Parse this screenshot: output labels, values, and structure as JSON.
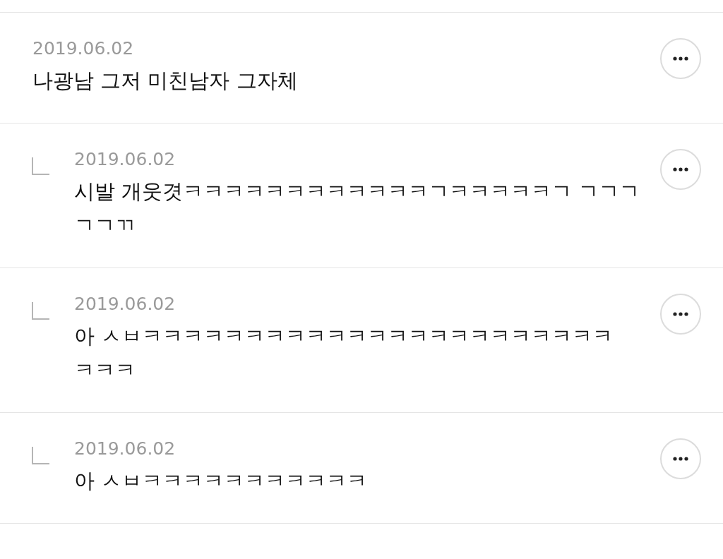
{
  "comments": [
    {
      "kind": "comment",
      "date": "2019.06.02",
      "lines": [
        "나광남 그저 미친남자 그자체"
      ]
    },
    {
      "kind": "reply",
      "date": "2019.06.02",
      "lines": [
        "시발 개웃겻ㅋㅋㅋㅋㅋㅋㅋㅋㅋㅋㅋㅋㄱㅋㅋㅋㅋㅋㄱ ㄱㄱㄱ",
        "ㄱㄱㄲ"
      ]
    },
    {
      "kind": "reply",
      "date": "2019.06.02",
      "lines": [
        "아 ㅅㅂㅋㅋㅋㅋㅋㅋㅋㅋㅋㅋㅋㅋㅋㅋㅋㅋㅋㅋㅋㅋㅋㅋㅋ",
        "ㅋㅋㅋ"
      ]
    },
    {
      "kind": "reply",
      "date": "2019.06.02",
      "lines": [
        "아 ㅅㅂㅋㅋㅋㅋㅋㅋㅋㅋㅋㅋㅋ"
      ]
    }
  ]
}
